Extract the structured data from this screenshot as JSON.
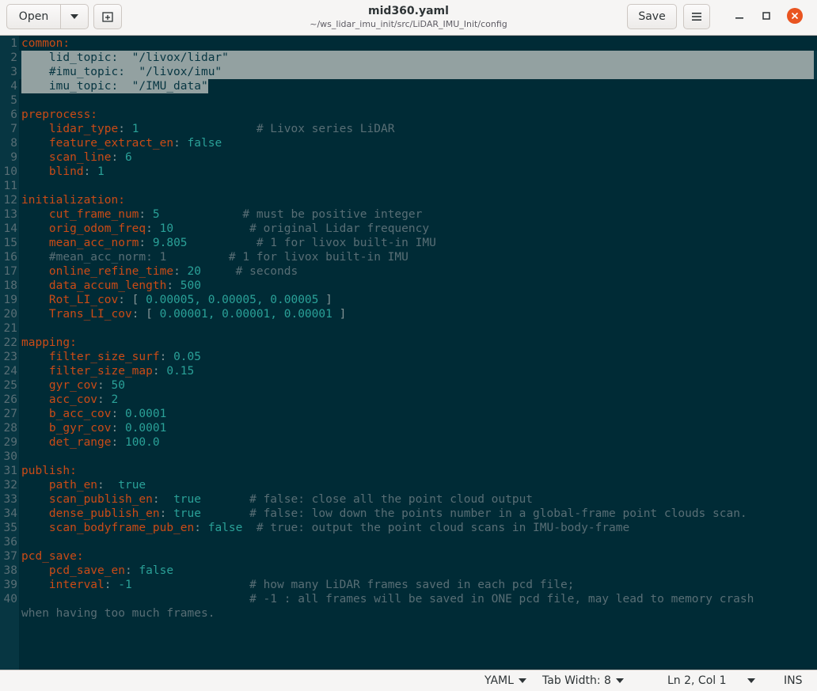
{
  "header": {
    "open_label": "Open",
    "save_label": "Save",
    "title": "mid360.yaml",
    "subtitle": "~/ws_lidar_imu_init/src/LiDAR_IMU_Init/config"
  },
  "editor": {
    "lines": [
      {
        "n": "1"
      },
      {
        "n": "2"
      },
      {
        "n": "3"
      },
      {
        "n": "4"
      },
      {
        "n": "5"
      },
      {
        "n": "6"
      },
      {
        "n": "7"
      },
      {
        "n": "8"
      },
      {
        "n": "9"
      },
      {
        "n": "10"
      },
      {
        "n": "11"
      },
      {
        "n": "12"
      },
      {
        "n": "13"
      },
      {
        "n": "14"
      },
      {
        "n": "15"
      },
      {
        "n": "16"
      },
      {
        "n": "17"
      },
      {
        "n": "18"
      },
      {
        "n": "19"
      },
      {
        "n": "20"
      },
      {
        "n": "21"
      },
      {
        "n": "22"
      },
      {
        "n": "23"
      },
      {
        "n": "24"
      },
      {
        "n": "25"
      },
      {
        "n": "26"
      },
      {
        "n": "27"
      },
      {
        "n": "28"
      },
      {
        "n": "29"
      },
      {
        "n": "30"
      },
      {
        "n": "31"
      },
      {
        "n": "32"
      },
      {
        "n": "33"
      },
      {
        "n": "34"
      },
      {
        "n": "35"
      },
      {
        "n": "36"
      },
      {
        "n": "37"
      },
      {
        "n": "38"
      },
      {
        "n": "39"
      },
      {
        "n": "40"
      }
    ],
    "text": {
      "l1": "common:",
      "l2": "    lid_topic:  \"/livox/lidar\"",
      "l3": "    #imu_topic:  \"/livox/imu\"",
      "l4": "    imu_topic:  \"/IMU_data\"",
      "l6": "preprocess:",
      "l7k": "    lidar_type",
      "l7v": "1",
      "l7c": "# Livox series LiDAR",
      "l8k": "    feature_extract_en",
      "l8v": "false",
      "l9k": "    scan_line",
      "l9v": "6",
      "l10k": "    blind",
      "l10v": "1",
      "l12": "initialization:",
      "l13k": "    cut_frame_num",
      "l13v": "5",
      "l13c": "# must be positive integer",
      "l14k": "    orig_odom_freq",
      "l14v": "10",
      "l14c": "# original Lidar frequency",
      "l15k": "    mean_acc_norm",
      "l15v": "9.805",
      "l15c": "# 1 for livox built-in IMU",
      "l16": "    #mean_acc_norm: 1         # 1 for livox built-in IMU",
      "l17k": "    online_refine_time",
      "l17v": "20",
      "l17c": "# seconds",
      "l18k": "    data_accum_length",
      "l18v": "500",
      "l19k": "    Rot_LI_cov",
      "l19v": "0.00005, 0.00005, 0.00005",
      "l20k": "    Trans_LI_cov",
      "l20v": "0.00001, 0.00001, 0.00001",
      "l22": "mapping:",
      "l23k": "    filter_size_surf",
      "l23v": "0.05",
      "l24k": "    filter_size_map",
      "l24v": "0.15",
      "l25k": "    gyr_cov",
      "l25v": "50",
      "l26k": "    acc_cov",
      "l26v": "2",
      "l27k": "    b_acc_cov",
      "l27v": "0.0001",
      "l28k": "    b_gyr_cov",
      "l28v": "0.0001",
      "l29k": "    det_range",
      "l29v": "100.0",
      "l31": "publish:",
      "l32k": "    path_en",
      "l32v": "true",
      "l33k": "    scan_publish_en",
      "l33v": "true",
      "l33c": "# false: close all the point cloud output",
      "l34k": "    dense_publish_en",
      "l34v": "true",
      "l34c": "# false: low down the points number in a global-frame point clouds scan.",
      "l35k": "    scan_bodyframe_pub_en",
      "l35v": "false",
      "l35c": "# true: output the point cloud scans in IMU-body-frame",
      "l37": "pcd_save:",
      "l38k": "    pcd_save_en",
      "l38v": "false",
      "l39k": "    interval",
      "l39v": "-1",
      "l39c": "# how many LiDAR frames saved in each pcd file;",
      "l40c": "# -1 : all frames will be saved in ONE pcd file, may lead to memory crash",
      "l40wrap": "when having too much frames."
    }
  },
  "status": {
    "language": "YAML",
    "tab_width": "Tab Width: 8",
    "position": "Ln 2, Col 1",
    "mode": "INS"
  }
}
